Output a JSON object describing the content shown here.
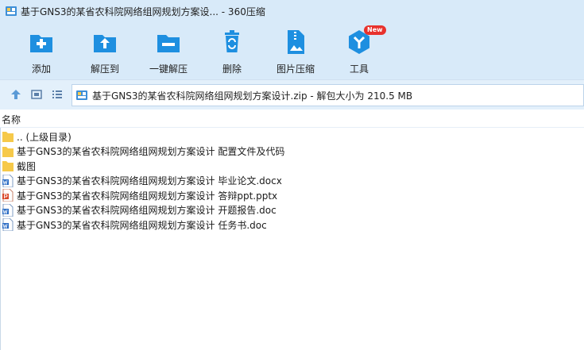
{
  "window": {
    "title": "基于GNS3的某省农科院网络组网规划方案设... - 360压缩"
  },
  "toolbar": {
    "items": [
      {
        "label": "添加",
        "icon": "add-icon"
      },
      {
        "label": "解压到",
        "icon": "extract-to-icon"
      },
      {
        "label": "一键解压",
        "icon": "one-click-extract-icon"
      },
      {
        "label": "删除",
        "icon": "delete-icon"
      },
      {
        "label": "图片压缩",
        "icon": "image-compress-icon"
      },
      {
        "label": "工具",
        "icon": "tools-icon",
        "badge": "New"
      }
    ]
  },
  "address": {
    "path": "基于GNS3的某省农科院网络组网规划方案设计.zip - 解包大小为 210.5 MB"
  },
  "columns": {
    "name": "名称"
  },
  "files": [
    {
      "name": ".. (上级目录)",
      "type": "folder"
    },
    {
      "name": "基于GNS3的某省农科院网络组网规划方案设计 配置文件及代码",
      "type": "folder"
    },
    {
      "name": "截图",
      "type": "folder"
    },
    {
      "name": "基于GNS3的某省农科院网络组网规划方案设计 毕业论文.docx",
      "type": "word"
    },
    {
      "name": "基于GNS3的某省农科院网络组网规划方案设计 答辩ppt.pptx",
      "type": "ppt"
    },
    {
      "name": "基于GNS3的某省农科院网络组网规划方案设计 开题报告.doc",
      "type": "word"
    },
    {
      "name": "基于GNS3的某省农科院网络组网规划方案设计 任务书.doc",
      "type": "word"
    }
  ],
  "colors": {
    "toolbar_bg": "#d8eaf9",
    "icon_blue": "#1e8fe0",
    "folder_yellow": "#f6c94a",
    "word_blue": "#2b6cc4",
    "ppt_red": "#d9482a",
    "badge_red": "#e8322d"
  }
}
